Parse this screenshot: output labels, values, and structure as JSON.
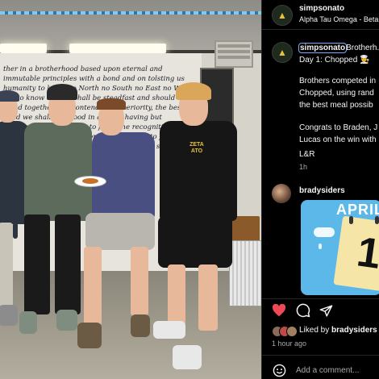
{
  "post_author": {
    "username": "simpsonato",
    "subtitle": "Alpha Tau Omega - Beta..."
  },
  "caption": {
    "username": "simpsonato",
    "line1": "Brotherh...",
    "line2": "Day 1: Chopped",
    "line2_emoji": "👨‍🍳",
    "para1": [
      "Brothers competed in",
      "Chopped, using rand",
      "the best meal possib"
    ],
    "para2": [
      "Congrats to Braden, J",
      "Lucas on the win with"
    ],
    "signoff": "L&R",
    "time": "1h"
  },
  "comment": {
    "username": "bradysiders",
    "calendar_month": "APRIL",
    "calendar_day": "1"
  },
  "actions": {
    "like_icon": "heart-filled-icon",
    "comment_icon": "comment-icon",
    "share_icon": "share-icon",
    "like_color": "#ed4956"
  },
  "likes": {
    "prefix": "Liked by",
    "user": "bradysiders"
  },
  "post_time": "1 hour ago",
  "add_comment": {
    "placeholder": "Add a comment...",
    "emoji_icon": "smiley-icon"
  },
  "photo": {
    "mural_text": "ther in a brotherhood based upon eternal and immutable principles with a bond and on tolsting us humanity to know no North no South no East no West but to know and we shall be steadfast and should stand together and contend for superiority, the best hand we shall find good in all, and having but wonderful contributions to fulfill the recognition of the fraternity over lords Beyond and nothing, to further the devotion of man we to be true to all the spirit of the founders of the fraternity."
  }
}
